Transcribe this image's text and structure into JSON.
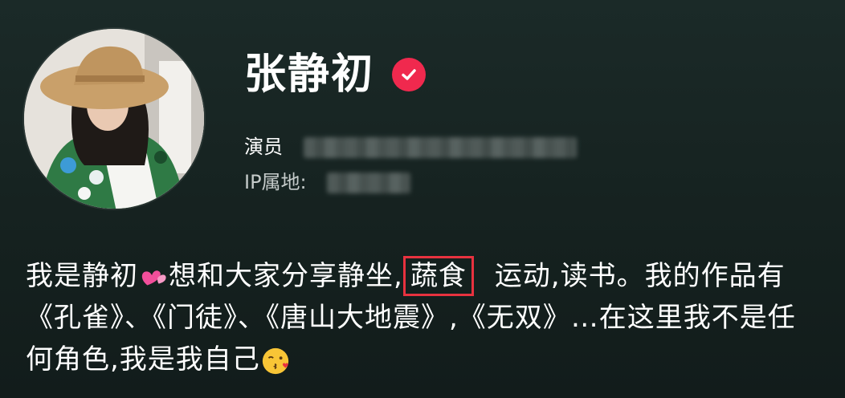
{
  "profile": {
    "name": "张静初",
    "role": "演员",
    "ip_label": "IP属地:",
    "verified_icon": "verified-check-icon",
    "accent_color": "#f0294e"
  },
  "bio": {
    "part1": "我是静初",
    "part2": "想和大家分享静坐,",
    "highlight": "蔬食",
    "part3": "运动,读书。我的作品有《孔雀》、《门徒》、《唐山大地震》,《无双》…在这里我不是任何角色,我是我自己",
    "highlight_color": "#e8323f",
    "emoji_heart": "two-hearts-emoji",
    "emoji_kiss": "kissing-heart-emoji"
  }
}
